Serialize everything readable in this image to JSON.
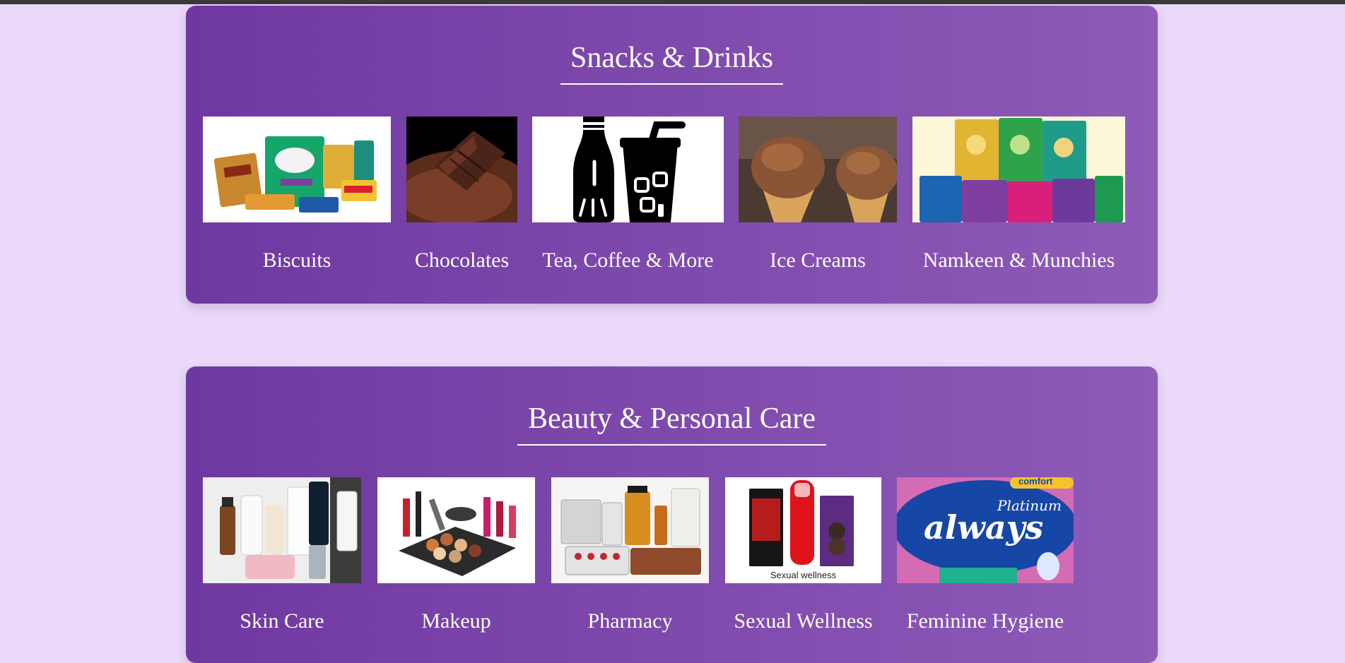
{
  "sections": [
    {
      "title": "Snacks & Drinks",
      "items": [
        {
          "label": "Biscuits",
          "icon": "biscuits-image"
        },
        {
          "label": "Chocolates",
          "icon": "chocolates-image"
        },
        {
          "label": "Tea, Coffee & More",
          "icon": "drinks-bottle-cup-icon"
        },
        {
          "label": "Ice Creams",
          "icon": "ice-creams-image"
        },
        {
          "label": "Namkeen & Munchies",
          "icon": "namkeen-packs-image"
        }
      ]
    },
    {
      "title": "Beauty & Personal Care",
      "items": [
        {
          "label": "Skin Care",
          "icon": "skin-care-image"
        },
        {
          "label": "Makeup",
          "icon": "makeup-image"
        },
        {
          "label": "Pharmacy",
          "icon": "pharmacy-image"
        },
        {
          "label": "Sexual Wellness",
          "icon": "sexual-wellness-image",
          "image_caption": "Sexual wellness"
        },
        {
          "label": "Feminine Hygiene",
          "icon": "feminine-hygiene-image",
          "image_text": [
            "Platinum",
            "always",
            "comfort"
          ]
        }
      ]
    }
  ],
  "colors": {
    "page_background": "#ead9f8",
    "section_gradient_start": "#6f38a1",
    "section_gradient_end": "#8e5bb8",
    "text": "#ffffff"
  }
}
